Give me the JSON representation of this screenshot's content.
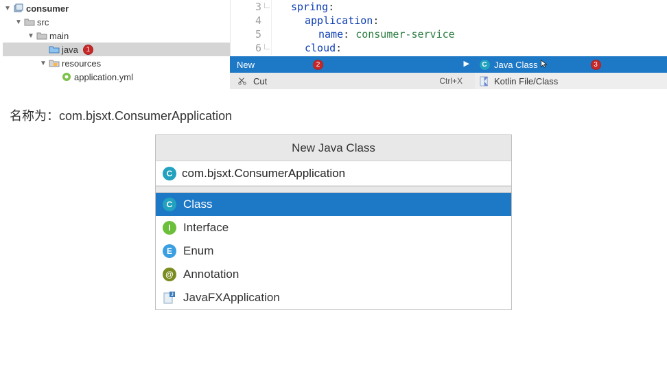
{
  "tree": {
    "root": {
      "label": "consumer"
    },
    "src": {
      "label": "src"
    },
    "main": {
      "label": "main"
    },
    "java": {
      "label": "java",
      "badge": "1"
    },
    "resources": {
      "label": "resources"
    },
    "appyml": {
      "label": "application.yml"
    }
  },
  "editor": {
    "lines": [
      {
        "num": "3",
        "indent": 1,
        "key": "spring",
        "suffix": ":"
      },
      {
        "num": "4",
        "indent": 2,
        "key": "application",
        "suffix": ":"
      },
      {
        "num": "5",
        "indent": 3,
        "key": "name",
        "suffix": ": ",
        "value": "consumer-service"
      },
      {
        "num": "6",
        "indent": 2,
        "key": "cloud",
        "suffix": ":"
      }
    ]
  },
  "context_menu": {
    "new": {
      "label": "New",
      "badge": "2"
    },
    "cut": {
      "label": "Cut",
      "shortcut": "Ctrl+X"
    },
    "java_class": {
      "label": "Java Class",
      "badge": "3"
    },
    "kotlin": {
      "label": "Kotlin File/Class"
    }
  },
  "caption": "名称为：com.bjsxt.ConsumerApplication",
  "dialog": {
    "title": "New Java Class",
    "input_value": "com.bjsxt.ConsumerApplication",
    "options": [
      {
        "kind": "C",
        "label": "Class",
        "selected": true
      },
      {
        "kind": "I",
        "label": "Interface",
        "selected": false
      },
      {
        "kind": "E",
        "label": "Enum",
        "selected": false
      },
      {
        "kind": "A",
        "label": "Annotation",
        "selected": false
      },
      {
        "kind": "FX",
        "label": "JavaFXApplication",
        "selected": false
      }
    ]
  }
}
